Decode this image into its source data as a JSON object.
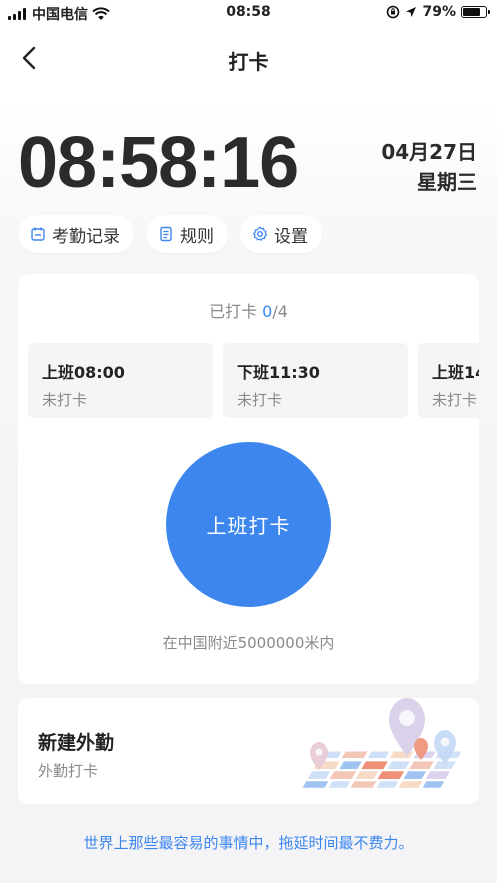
{
  "status_bar": {
    "carrier": "中国电信",
    "time": "08:58",
    "battery_percent": "79%",
    "battery_level": 0.79,
    "icons": [
      "signal-icon",
      "wifi-icon",
      "rotation-lock-icon",
      "location-arrow-icon",
      "battery-icon"
    ]
  },
  "nav": {
    "title": "打卡",
    "back_icon": "chevron-left-icon"
  },
  "clock": {
    "time": "08:58:16",
    "date": "04月27日",
    "weekday": "星期三"
  },
  "pills": [
    {
      "label": "考勤记录",
      "icon": "calendar-icon"
    },
    {
      "label": "规则",
      "icon": "document-icon"
    },
    {
      "label": "设置",
      "icon": "gear-icon"
    }
  ],
  "attendance": {
    "progress_prefix": "已打卡 ",
    "progress_count": "0",
    "progress_total": "/4",
    "shifts": [
      {
        "title": "上班08:00",
        "status": "未打卡"
      },
      {
        "title": "下班11:30",
        "status": "未打卡"
      },
      {
        "title": "上班14",
        "status": "未打卡"
      }
    ],
    "punch_button": "上班打卡",
    "location_text": "在中国附近5000000米内"
  },
  "field_work": {
    "title": "新建外勤",
    "subtitle": "外勤打卡"
  },
  "quote": "世界上那些最容易的事情中，拖延时间最不费力。",
  "colors": {
    "accent": "#3c86ee",
    "text_secondary": "#8a8a8a",
    "card_bg": "#ffffff",
    "shift_bg": "#f5f5f6"
  }
}
